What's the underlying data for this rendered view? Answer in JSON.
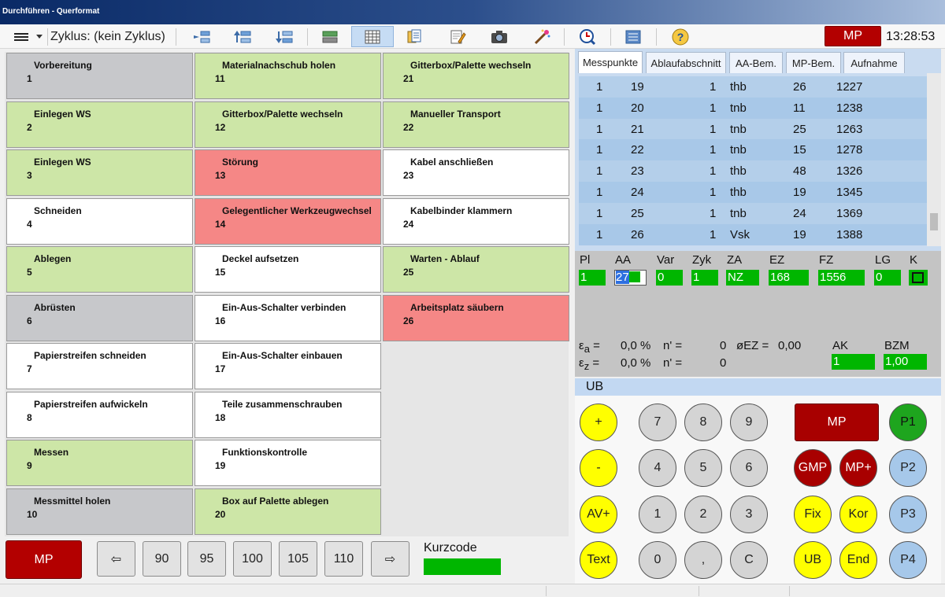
{
  "window": {
    "title": "Durchführen - Querformat"
  },
  "toolbar": {
    "cycle_label": "Zyklus: (kein Zyklus)",
    "mp_label": "MP",
    "clock": "13:28:53",
    "icons": [
      "menu-icon",
      "dropdown-arrow-icon",
      "insert-before-icon",
      "move-up-icon",
      "move-down-icon",
      "green-bar-icon",
      "grid-view-icon",
      "copy-document-icon",
      "edit-note-icon",
      "camera-icon",
      "magic-wand-icon",
      "clock-search-icon",
      "list-view-icon",
      "help-icon"
    ]
  },
  "tiles": [
    {
      "label": "Vorbereitung",
      "num": "1",
      "color": "gray"
    },
    {
      "label": "Einlegen WS",
      "num": "2",
      "color": "green"
    },
    {
      "label": "Einlegen WS",
      "num": "3",
      "color": "green"
    },
    {
      "label": "Schneiden",
      "num": "4",
      "color": "white"
    },
    {
      "label": "Ablegen",
      "num": "5",
      "color": "green"
    },
    {
      "label": "Abrüsten",
      "num": "6",
      "color": "gray"
    },
    {
      "label": "Papierstreifen schneiden",
      "num": "7",
      "color": "white"
    },
    {
      "label": "Papierstreifen aufwickeln",
      "num": "8",
      "color": "white"
    },
    {
      "label": "Messen",
      "num": "9",
      "color": "green"
    },
    {
      "label": "Messmittel holen",
      "num": "10",
      "color": "gray"
    },
    {
      "label": "Materialnachschub holen",
      "num": "11",
      "color": "green"
    },
    {
      "label": "Gitterbox/Palette wechseln",
      "num": "12",
      "color": "green"
    },
    {
      "label": "Störung",
      "num": "13",
      "color": "red"
    },
    {
      "label": "Gelegentlicher Werkzeugwechsel",
      "num": "14",
      "color": "red"
    },
    {
      "label": "Deckel aufsetzen",
      "num": "15",
      "color": "white"
    },
    {
      "label": "Ein-Aus-Schalter verbinden",
      "num": "16",
      "color": "white"
    },
    {
      "label": "Ein-Aus-Schalter einbauen",
      "num": "17",
      "color": "white"
    },
    {
      "label": "Teile zusammenschrauben",
      "num": "18",
      "color": "white"
    },
    {
      "label": "Funktionskontrolle",
      "num": "19",
      "color": "white"
    },
    {
      "label": "Box auf Palette ablegen",
      "num": "20",
      "color": "green"
    },
    {
      "label": "Gitterbox/Palette wechseln",
      "num": "21",
      "color": "green"
    },
    {
      "label": "Manueller Transport",
      "num": "22",
      "color": "green"
    },
    {
      "label": "Kabel anschließen",
      "num": "23",
      "color": "white"
    },
    {
      "label": "Kabelbinder klammern",
      "num": "24",
      "color": "white"
    },
    {
      "label": "Warten - Ablauf",
      "num": "25",
      "color": "green"
    },
    {
      "label": "Arbeitsplatz säubern",
      "num": "26",
      "color": "red"
    }
  ],
  "bottom": {
    "mp_label": "MP",
    "left_arrow": "⇦",
    "presets": [
      "90",
      "95",
      "100",
      "105",
      "110"
    ],
    "right_arrow": "⇨",
    "kurzcode_label": "Kurzcode"
  },
  "tabs": [
    "Messpunkte",
    "Ablaufabschnitt",
    "AA-Bem.",
    "MP-Bem.",
    "Aufnahme"
  ],
  "table_rows": [
    [
      "1",
      "19",
      "1",
      "thb",
      "26",
      "1227"
    ],
    [
      "1",
      "20",
      "1",
      "tnb",
      "11",
      "1238"
    ],
    [
      "1",
      "21",
      "1",
      "tnb",
      "25",
      "1263"
    ],
    [
      "1",
      "22",
      "1",
      "tnb",
      "15",
      "1278"
    ],
    [
      "1",
      "23",
      "1",
      "thb",
      "48",
      "1326"
    ],
    [
      "1",
      "24",
      "1",
      "thb",
      "19",
      "1345"
    ],
    [
      "1",
      "25",
      "1",
      "tnb",
      "24",
      "1369"
    ],
    [
      "1",
      "26",
      "1",
      "Vsk",
      "19",
      "1388"
    ]
  ],
  "form": {
    "labels": [
      "Pl",
      "AA",
      "Var",
      "Zyk",
      "ZA",
      "EZ",
      "FZ",
      "LG",
      "K"
    ],
    "values": [
      "1",
      "27",
      "0",
      "1",
      "NZ",
      "168",
      "1556",
      "0",
      ""
    ]
  },
  "stats": {
    "ea_sym": "ε",
    "ea_sub": "a",
    "ea_eq": "=",
    "ea_val": "0,0 %",
    "ea_n": "n' =",
    "ea_n_val": "0",
    "oez_label": "øEZ =",
    "oez_val": "0,00",
    "ez_sym": "ε",
    "ez_sub": "z",
    "ez_eq": "=",
    "ez_val": "0,0 %",
    "ez_n": "n' =",
    "ez_n_val": "0",
    "ak_label": "AK",
    "ak_val": "1",
    "bzm_label": "BZM",
    "bzm_val": "1,00"
  },
  "ub_label": "UB",
  "keypad": {
    "left": [
      "+",
      "-",
      "AV+",
      "Text"
    ],
    "digits": [
      [
        "7",
        "8",
        "9"
      ],
      [
        "4",
        "5",
        "6"
      ],
      [
        "1",
        "2",
        "3"
      ],
      [
        "0",
        ",",
        "C"
      ]
    ],
    "mp": "MP",
    "gmp": "GMP",
    "mpplus": "MP+",
    "fix": "Fix",
    "kor": "Kor",
    "ub": "UB",
    "end": "End",
    "p": [
      "P1",
      "P2",
      "P3",
      "P4"
    ]
  }
}
